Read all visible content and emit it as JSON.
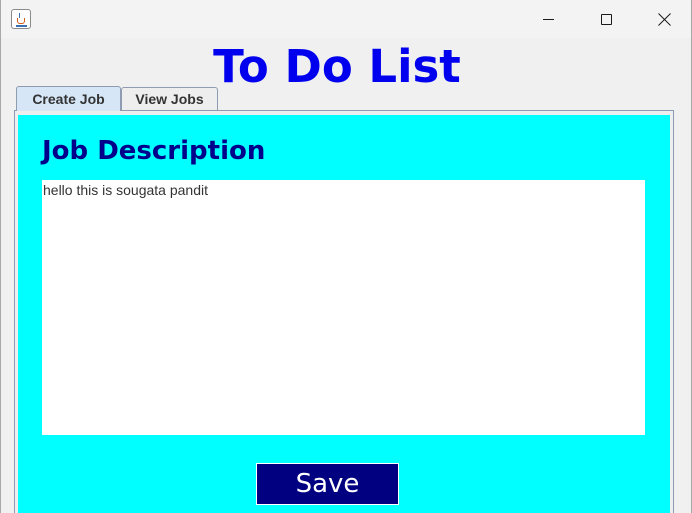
{
  "window": {
    "title": "",
    "controls": [
      "minimize-icon",
      "maximize-icon",
      "close-icon"
    ]
  },
  "header": {
    "title": "To Do List"
  },
  "tabs": [
    {
      "label": "Create Job",
      "selected": true
    },
    {
      "label": "View Jobs",
      "selected": false
    }
  ],
  "create_job": {
    "section_title": "Job Description",
    "description_value": "hello this is sougata pandit",
    "save_label": "Save"
  },
  "colors": {
    "title": "#0000ee",
    "panel_background": "#00ffff",
    "section_title": "#00008b",
    "save_button": "#000080",
    "save_text": "#ffffff"
  }
}
